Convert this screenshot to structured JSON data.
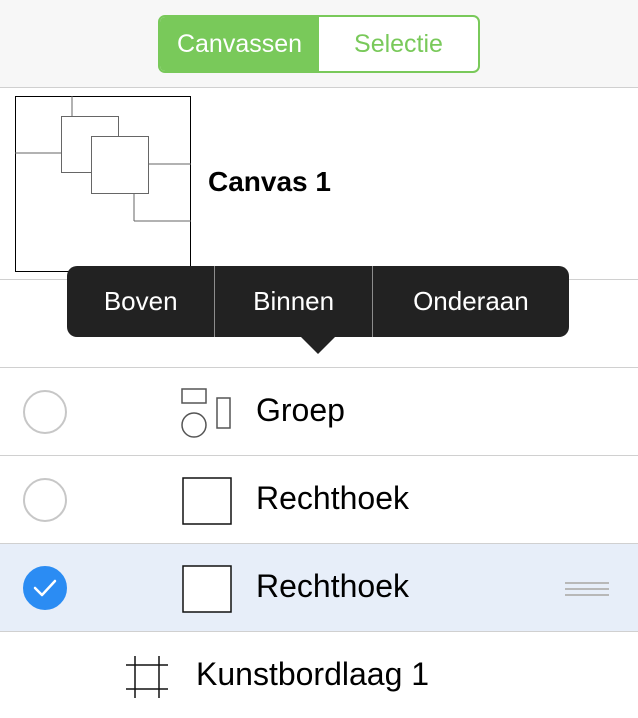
{
  "header": {
    "segments": [
      {
        "label": "Canvassen",
        "active": true
      },
      {
        "label": "Selectie",
        "active": false
      }
    ],
    "accent_color": "#79c95a"
  },
  "canvas": {
    "name": "Canvas 1",
    "thumbnail_icon": "canvas-thumbnail"
  },
  "popover": {
    "items": [
      "Boven",
      "Binnen",
      "Onderaan"
    ]
  },
  "layers": [
    {
      "label": "Groep",
      "icon": "group-shapes-icon",
      "checked": false
    },
    {
      "label": "Rechthoek",
      "icon": "rectangle-icon",
      "checked": false
    },
    {
      "label": "Rechthoek",
      "icon": "rectangle-icon",
      "checked": true,
      "selected": true
    }
  ],
  "artboard_layer": {
    "label": "Kunstbordlaag 1",
    "icon": "artboard-icon"
  },
  "colors": {
    "check_blue": "#2b8cf3",
    "selected_row": "#e7eef9",
    "popover_bg": "#222222"
  }
}
